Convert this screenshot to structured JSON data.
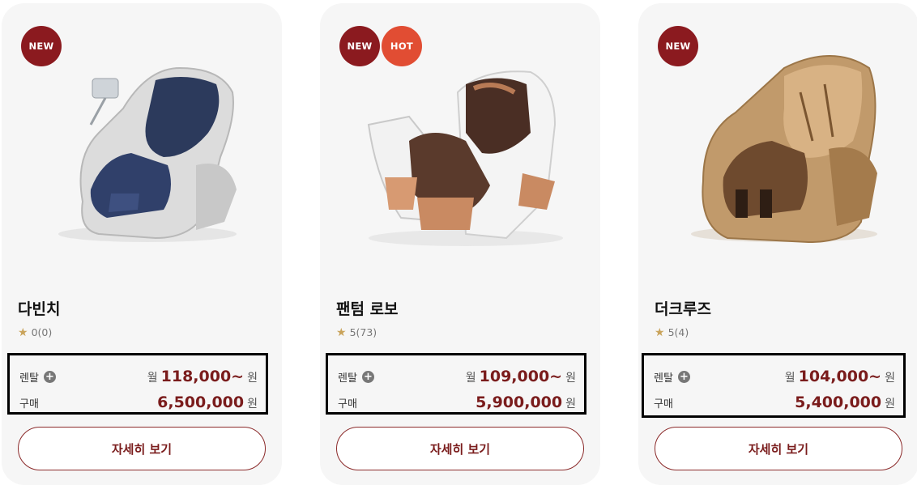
{
  "products": [
    {
      "name": "다빈치",
      "badges": [
        "NEW"
      ],
      "rating": "0(0)",
      "rental_label": "렌탈",
      "rental_prefix": "월",
      "rental_price": "118,000~",
      "rental_unit": "원",
      "buy_label": "구매",
      "buy_price": "6,500,000",
      "buy_unit": "원",
      "button_label": "자세히 보기"
    },
    {
      "name": "팬텀 로보",
      "badges": [
        "NEW",
        "HOT"
      ],
      "rating": "5(73)",
      "rental_label": "렌탈",
      "rental_prefix": "월",
      "rental_price": "109,000~",
      "rental_unit": "원",
      "buy_label": "구매",
      "buy_price": "5,900,000",
      "buy_unit": "원",
      "button_label": "자세히 보기"
    },
    {
      "name": "더크루즈",
      "badges": [
        "NEW"
      ],
      "rating": "5(4)",
      "rental_label": "렌탈",
      "rental_prefix": "월",
      "rental_price": "104,000~",
      "rental_unit": "원",
      "buy_label": "구매",
      "buy_price": "5,400,000",
      "buy_unit": "원",
      "button_label": "자세히 보기"
    }
  ],
  "colors": {
    "badge_new": "#8b1a1f",
    "badge_hot": "#e14d33",
    "price": "#7a1c1c",
    "star": "#c9a35a"
  },
  "icons": {
    "star": "star-icon",
    "plus": "plus-circle-icon"
  }
}
